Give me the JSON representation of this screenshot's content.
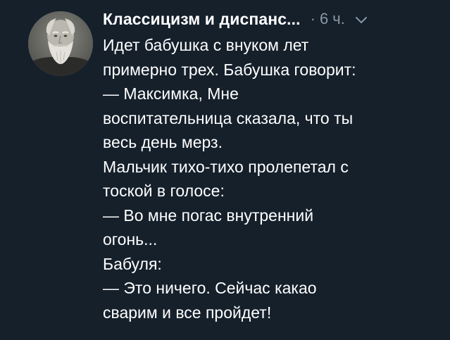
{
  "tweet": {
    "author": "Классицизм и диспанс...",
    "separator": "·",
    "time": "6 ч.",
    "avatar_icon": "bearded-old-man-portrait",
    "chevron_icon": "chevron-down-icon",
    "text_lines": [
      "Идет бабушка с внуком лет",
      "примерно трех. Бабушка говорит:",
      "— Максимка, Мне",
      "воспитательница сказала, что ты",
      "весь день мерз.",
      "Мальчик тихо-тихо пролепетал с",
      "тоской в голосе:",
      "— Во мне погас внутренний",
      "огонь...",
      "Бабуля:",
      "— Это ничего. Сейчас какао",
      "сварим и все пройдет!"
    ]
  },
  "colors": {
    "background": "#15202b",
    "primary_text": "#ffffff",
    "secondary_text": "#8899a6"
  }
}
